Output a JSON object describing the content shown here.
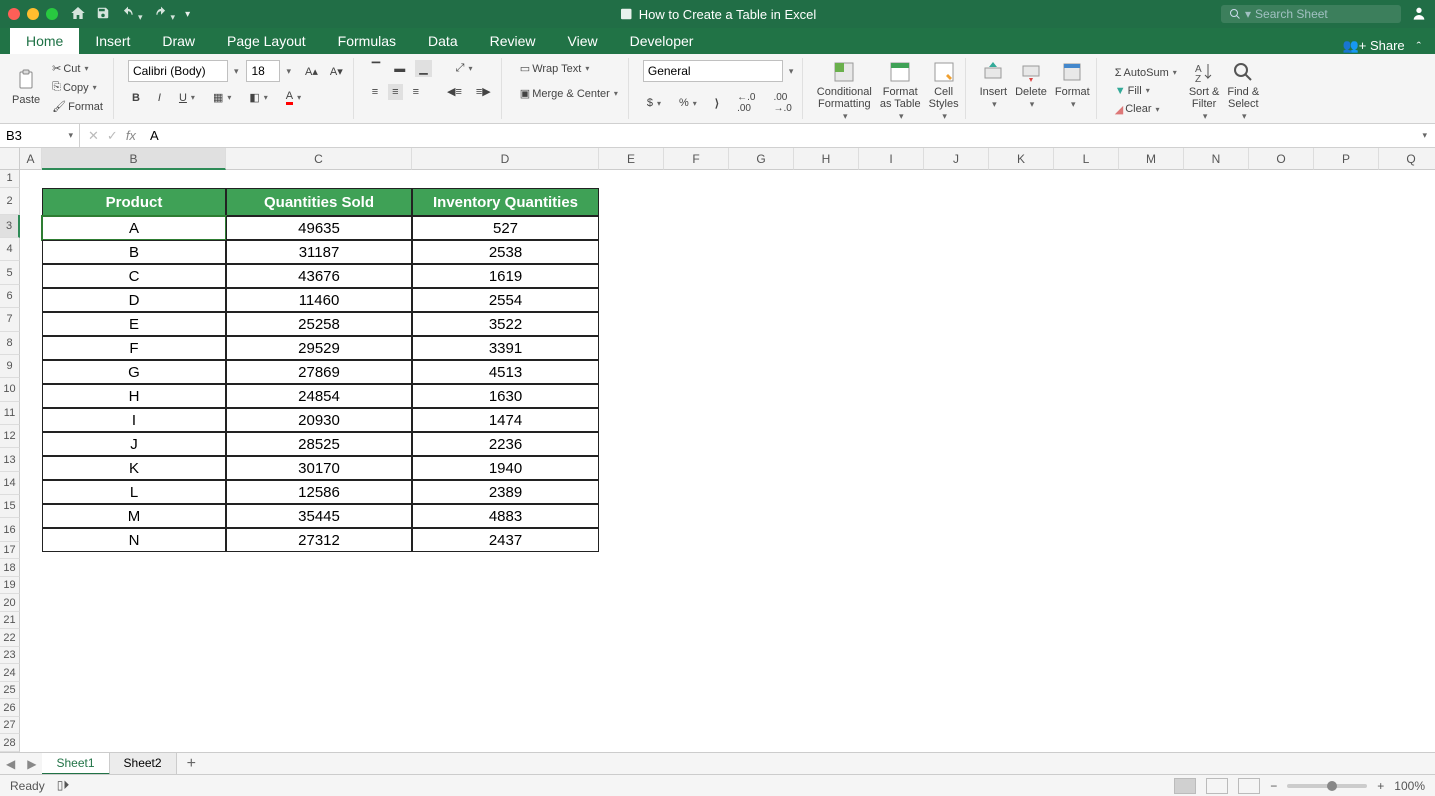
{
  "title": "How to Create a Table in Excel",
  "search_placeholder": "Search Sheet",
  "tabs": [
    "Home",
    "Insert",
    "Draw",
    "Page Layout",
    "Formulas",
    "Data",
    "Review",
    "View",
    "Developer"
  ],
  "active_tab": "Home",
  "share_label": "Share",
  "clipboard": {
    "paste": "Paste",
    "cut": "Cut",
    "copy": "Copy",
    "format": "Format"
  },
  "font": {
    "name": "Calibri (Body)",
    "size": "18"
  },
  "align": {
    "wrap": "Wrap Text",
    "merge": "Merge & Center"
  },
  "number": {
    "format": "General"
  },
  "styles": {
    "cf": "Conditional\nFormatting",
    "fat": "Format\nas Table",
    "cs": "Cell\nStyles"
  },
  "cells": {
    "insert": "Insert",
    "delete": "Delete",
    "format": "Format"
  },
  "editing": {
    "autosum": "AutoSum",
    "fill": "Fill",
    "clear": "Clear",
    "sort": "Sort &\nFilter",
    "find": "Find &\nSelect"
  },
  "namebox": "B3",
  "formula_value": "A",
  "cols": [
    "A",
    "B",
    "C",
    "D",
    "E",
    "F",
    "G",
    "H",
    "I",
    "J",
    "K",
    "L",
    "M",
    "N",
    "O",
    "P",
    "Q"
  ],
  "col_widths": {
    "A": 22,
    "B": 184,
    "C": 186,
    "D": 187,
    "def": 65
  },
  "sel_col": "B",
  "sel_row": 3,
  "row_count": 28,
  "table": {
    "headers": [
      "Product",
      "Quantities Sold",
      "Inventory Quantities"
    ],
    "rows": [
      [
        "A",
        "49635",
        "527"
      ],
      [
        "B",
        "31187",
        "2538"
      ],
      [
        "C",
        "43676",
        "1619"
      ],
      [
        "D",
        "11460",
        "2554"
      ],
      [
        "E",
        "25258",
        "3522"
      ],
      [
        "F",
        "29529",
        "3391"
      ],
      [
        "G",
        "27869",
        "4513"
      ],
      [
        "H",
        "24854",
        "1630"
      ],
      [
        "I",
        "20930",
        "1474"
      ],
      [
        "J",
        "28525",
        "2236"
      ],
      [
        "K",
        "30170",
        "1940"
      ],
      [
        "L",
        "12586",
        "2389"
      ],
      [
        "M",
        "35445",
        "4883"
      ],
      [
        "N",
        "27312",
        "2437"
      ]
    ]
  },
  "sheets": [
    "Sheet1",
    "Sheet2"
  ],
  "active_sheet": "Sheet1",
  "status": "Ready",
  "zoom": "100%"
}
